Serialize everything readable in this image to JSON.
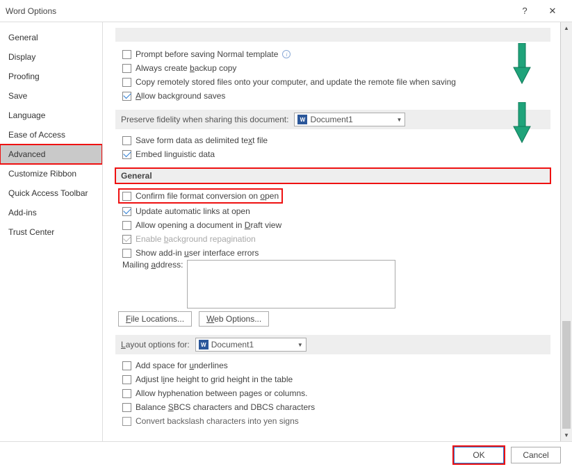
{
  "window": {
    "title": "Word Options",
    "help_icon": "?",
    "close_icon": "✕"
  },
  "sidebar": {
    "items": [
      {
        "label": "General"
      },
      {
        "label": "Display"
      },
      {
        "label": "Proofing"
      },
      {
        "label": "Save"
      },
      {
        "label": "Language"
      },
      {
        "label": "Ease of Access"
      },
      {
        "label": "Advanced",
        "selected": true
      },
      {
        "label": "Customize Ribbon"
      },
      {
        "label": "Quick Access Toolbar"
      },
      {
        "label": "Add-ins"
      },
      {
        "label": "Trust Center"
      }
    ]
  },
  "save_section": {
    "prompt_normal": "Prompt before saving Normal template",
    "backup": "Always create backup copy",
    "copy_remote": "Copy remotely stored files onto your computer, and update the remote file when saving",
    "bg_saves": "Allow background saves"
  },
  "fidelity": {
    "header": "Preserve fidelity when sharing this document:",
    "doc_name": "Document1",
    "save_form": "Save form data as delimited text file",
    "embed_ling": "Embed linguistic data"
  },
  "general": {
    "header": "General",
    "confirm_conv": "Confirm file format conversion on open",
    "update_links": "Update automatic links at open",
    "draft_view": "Allow opening a document in Draft view",
    "bg_repag": "Enable background repagination",
    "addin_errors": "Show add-in user interface errors",
    "mailing_label": "Mailing address:",
    "file_loc_btn": "File Locations...",
    "web_opt_btn": "Web Options..."
  },
  "layout": {
    "header": "Layout options for:",
    "doc_name": "Document1",
    "underlines": "Add space for underlines",
    "grid_height": "Adjust line height to grid height in the table",
    "hyphenation": "Allow hyphenation between pages or columns.",
    "sbcs": "Balance SBCS characters and DBCS characters",
    "yen": "Convert backslash characters into yen signs"
  },
  "footer": {
    "ok": "OK",
    "cancel": "Cancel"
  }
}
